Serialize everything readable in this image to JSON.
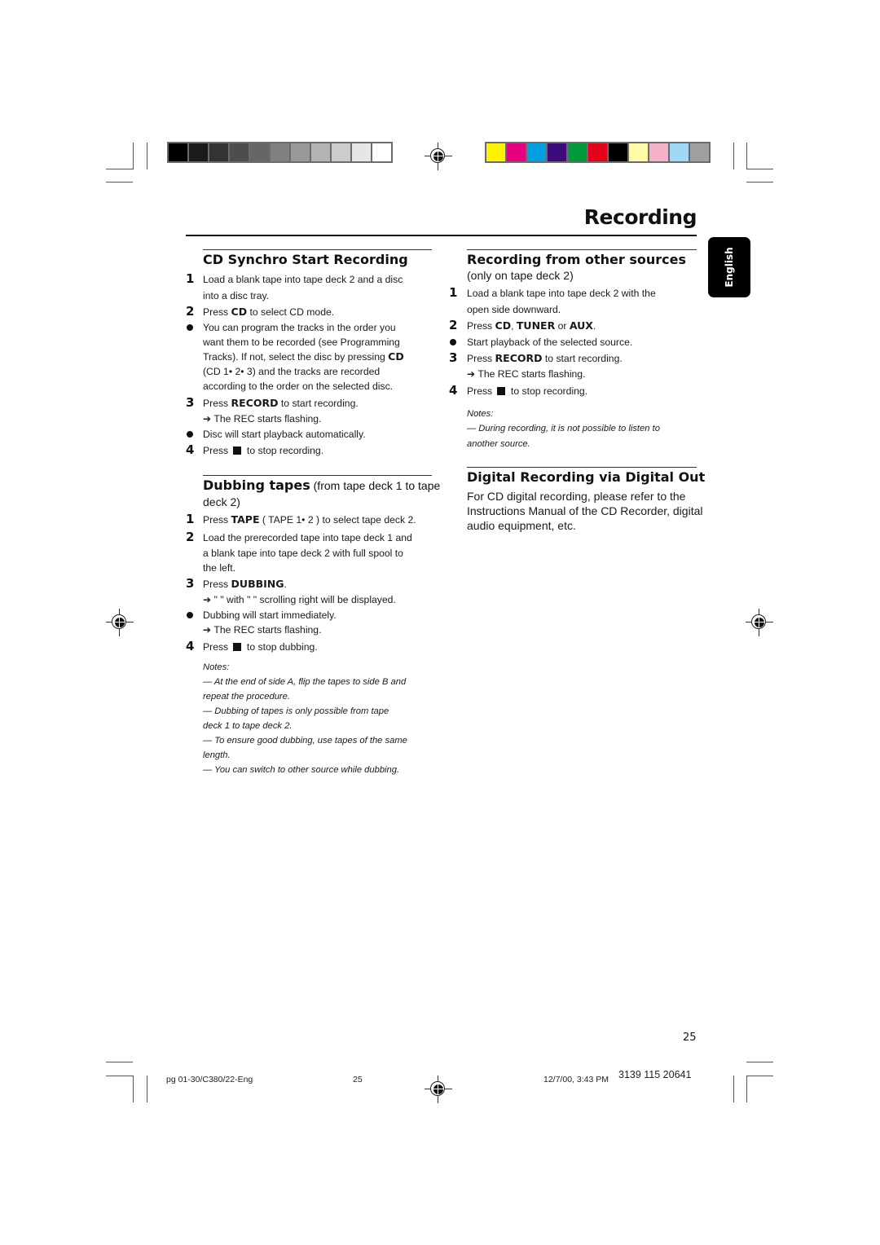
{
  "color_bars": {
    "grayscale": [
      "#000000",
      "#1a1a1a",
      "#333333",
      "#4d4d4d",
      "#666666",
      "#808080",
      "#999999",
      "#b3b3b3",
      "#cccccc",
      "#e6e6e6",
      "#ffffff"
    ],
    "process": [
      "#fff200",
      "#e5007e",
      "#00a0e3",
      "#3d0b7c",
      "#009a3d",
      "#e2001a",
      "#000000",
      "#fff9a8",
      "#f5b1c9",
      "#a0d8f5",
      "#a0a0a0"
    ]
  },
  "page_title": "Recording",
  "language_tab": "English",
  "left": {
    "cd_synchro": {
      "heading": "CD Synchro Start Recording",
      "steps": [
        {
          "marker": "1",
          "lines": [
            "Load a blank tape into tape deck 2 and a disc",
            "into a disc tray."
          ]
        },
        {
          "marker": "2",
          "pre": "Press ",
          "bold": "CD",
          "post": " to select CD mode."
        },
        {
          "marker": "bullet",
          "lines": [
            "You can program the tracks in the order you",
            "want them to be recorded (see Programming"
          ],
          "line3_pre": "Tracks). If not,  select the disc by pressing ",
          "line3_bold": "CD",
          "lines_after": [
            "(CD  1• 2• 3) and the tracks are recorded",
            "according to the order on the selected disc."
          ]
        },
        {
          "marker": "3",
          "pre": "Press ",
          "bold": "RECORD",
          "post": " to start recording.",
          "arrow": "The REC starts flashing."
        },
        {
          "marker": "bullet",
          "lines": [
            "Disc will start playback automatically."
          ]
        },
        {
          "marker": "4",
          "pre": "Press ",
          "post": " to stop recording."
        }
      ]
    },
    "dubbing": {
      "heading": "Dubbing tapes",
      "heading_sub": " (from tape deck 1 to tape",
      "heading_sub2": "deck 2)",
      "steps": [
        {
          "marker": "1",
          "pre": "Press ",
          "bold": "TAPE",
          "post": " ( TAPE 1• 2 ) to select tape deck 2."
        },
        {
          "marker": "2",
          "lines": [
            "Load the prerecorded tape into tape deck 1 and",
            "a blank tape into tape deck 2 with full spool to",
            "the left."
          ]
        },
        {
          "marker": "3",
          "pre": "Press ",
          "bold": "DUBBING",
          "post": ".",
          "arrow": "\"        \" with \"   \" scrolling right will be displayed."
        },
        {
          "marker": "bullet",
          "lines": [
            "Dubbing will start immediately."
          ],
          "arrow": "The REC starts flashing."
        },
        {
          "marker": "4",
          "pre": "Press ",
          "post": " to stop dubbing."
        }
      ],
      "notes_label": "Notes:",
      "notes": [
        "— At the end of side A, flip the tapes to side B and",
        "repeat the procedure.",
        "— Dubbing of tapes is only possible from tape",
        "deck 1 to tape deck 2.",
        "— To ensure good dubbing, use tapes of the same",
        "length.",
        "— You can switch to other source while dubbing."
      ]
    }
  },
  "right": {
    "other_sources": {
      "heading": "Recording from other sources",
      "subheading": "(only on tape deck 2)",
      "step1": [
        "Load a blank tape into tape deck 2 with the",
        "open side downward."
      ],
      "step2": {
        "pre": "Press ",
        "b1": "CD",
        "sep1": ", ",
        "b2": "TUNER",
        "sep2": " or ",
        "b3": "AUX",
        "post": "."
      },
      "bullet": "Start playback of the selected source.",
      "step3": {
        "pre": "Press ",
        "bold": "RECORD",
        "post": " to start recording.",
        "arrow": "The REC starts flashing."
      },
      "step4": {
        "pre": "Press ",
        "post": " to stop recording."
      },
      "notes_label": "Notes:",
      "notes": [
        "— During recording, it is not possible to listen to",
        "another source."
      ]
    },
    "digital_out": {
      "heading": "Digital Recording via Digital Out",
      "body": [
        "For CD digital recording, please refer to the",
        "Instructions Manual of the CD Recorder, digital",
        "audio equipment, etc."
      ]
    }
  },
  "page_number": "25",
  "footer": {
    "file": "pg  01-30/C380/22-Eng",
    "page": "25",
    "datetime": "12/7/00, 3:43 PM",
    "code": "3139 115 20641"
  },
  "markers": {
    "one": "1",
    "two": "2",
    "three": "3",
    "four": "4",
    "arrow": "➔"
  }
}
